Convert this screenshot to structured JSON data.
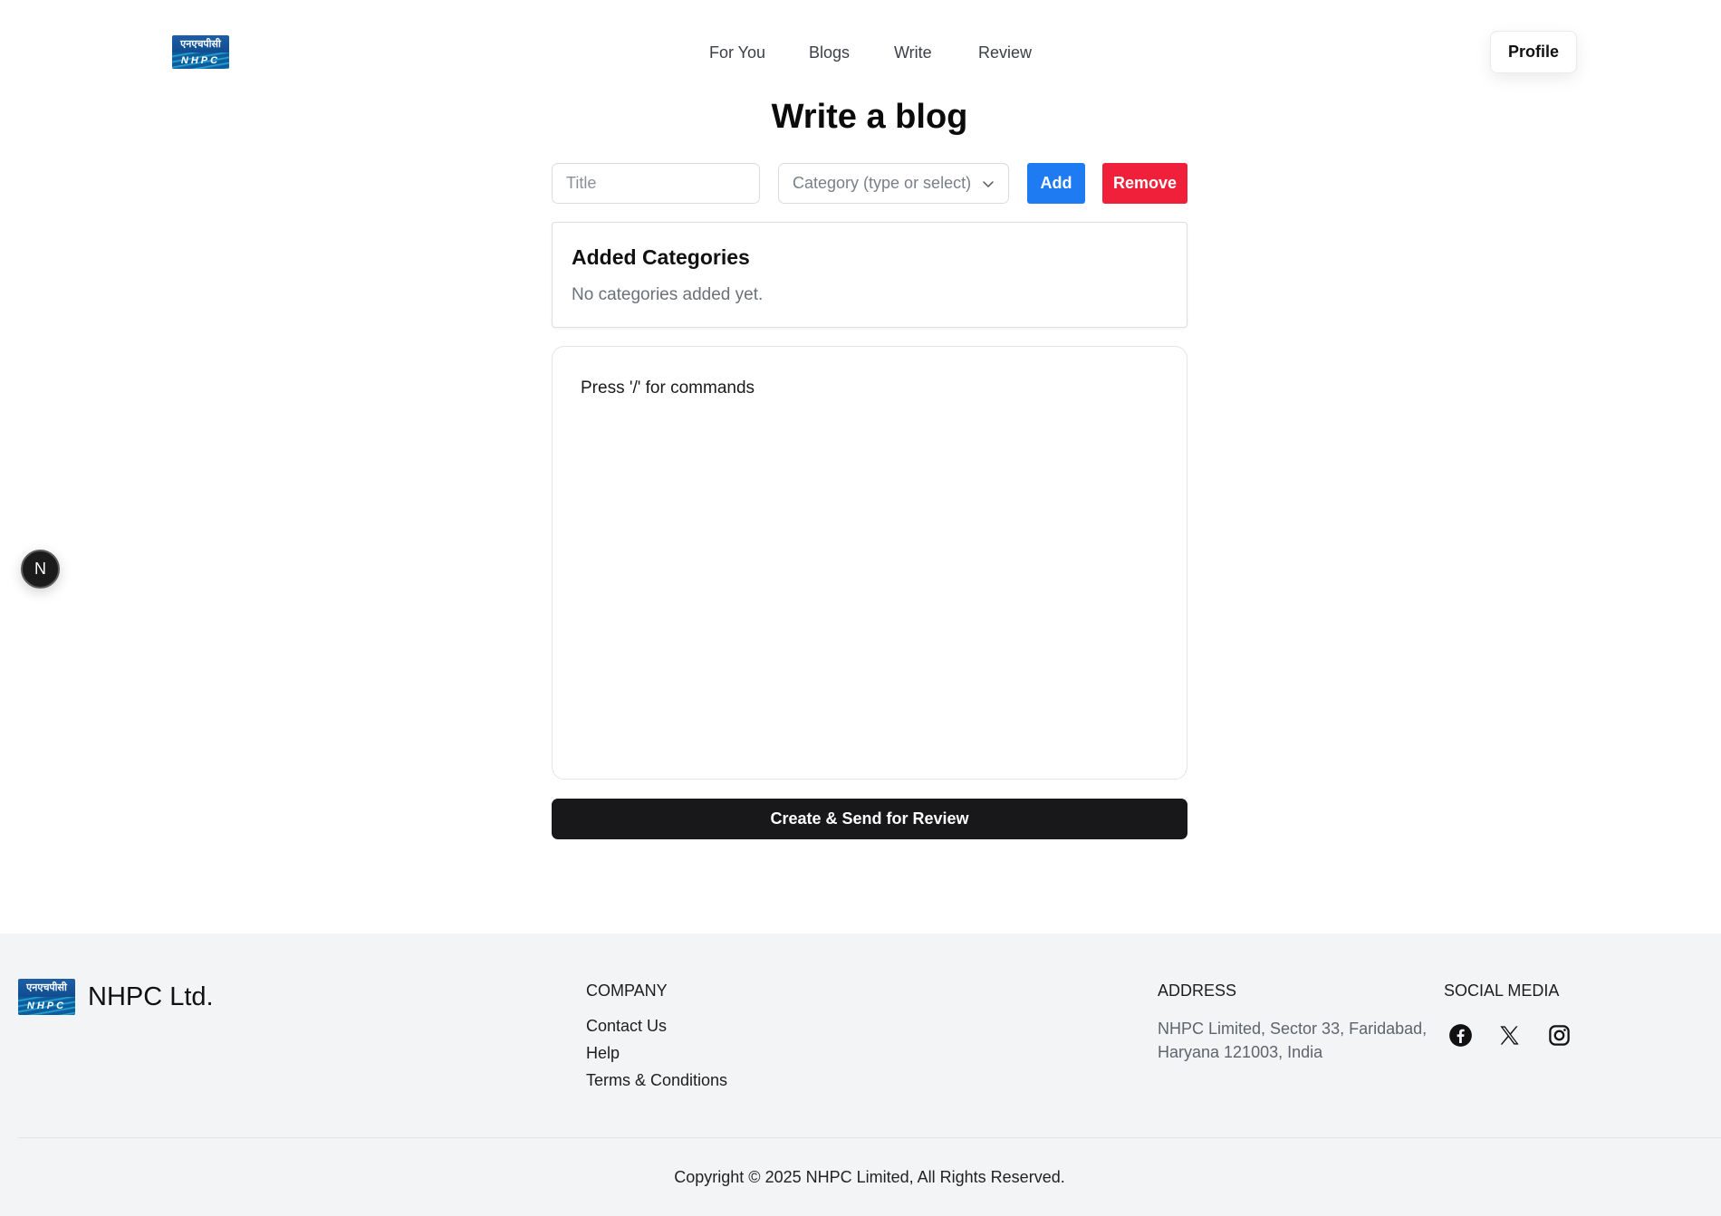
{
  "header": {
    "logo": {
      "hindi_text": "एनएचपीसी",
      "latin_text": "NHPC"
    },
    "nav": [
      {
        "label": "For You"
      },
      {
        "label": "Blogs"
      },
      {
        "label": "Write"
      },
      {
        "label": "Review"
      }
    ],
    "profile_label": "Profile"
  },
  "main": {
    "title": "Write a blog",
    "title_input": {
      "placeholder": "Title",
      "value": ""
    },
    "category_select": {
      "placeholder": "Category (type or select)"
    },
    "add_label": "Add",
    "remove_label": "Remove",
    "categories_card": {
      "heading": "Added Categories",
      "empty_text": "No categories added yet."
    },
    "editor": {
      "hint": "Press '/' for commands"
    },
    "submit_label": "Create & Send for Review"
  },
  "dev_badge": {
    "label": "N"
  },
  "footer": {
    "brand": "NHPC Ltd.",
    "company": {
      "title": "COMPANY",
      "links": [
        {
          "label": "Contact Us"
        },
        {
          "label": "Help"
        },
        {
          "label": "Terms & Conditions"
        }
      ]
    },
    "address": {
      "title": "ADDRESS",
      "text": "NHPC Limited, Sector 33, Faridabad, Haryana 121003, India"
    },
    "social": {
      "title": "SOCIAL MEDIA",
      "icons": [
        "facebook-icon",
        "x-icon",
        "instagram-icon"
      ]
    },
    "copyright": "Copyright © 2025 NHPC Limited, All Rights Reserved."
  },
  "colors": {
    "add_button": "#1f7bf2",
    "remove_button": "#f0203a",
    "submit_button": "#18181b",
    "footer_bg": "#f3f4f6"
  }
}
